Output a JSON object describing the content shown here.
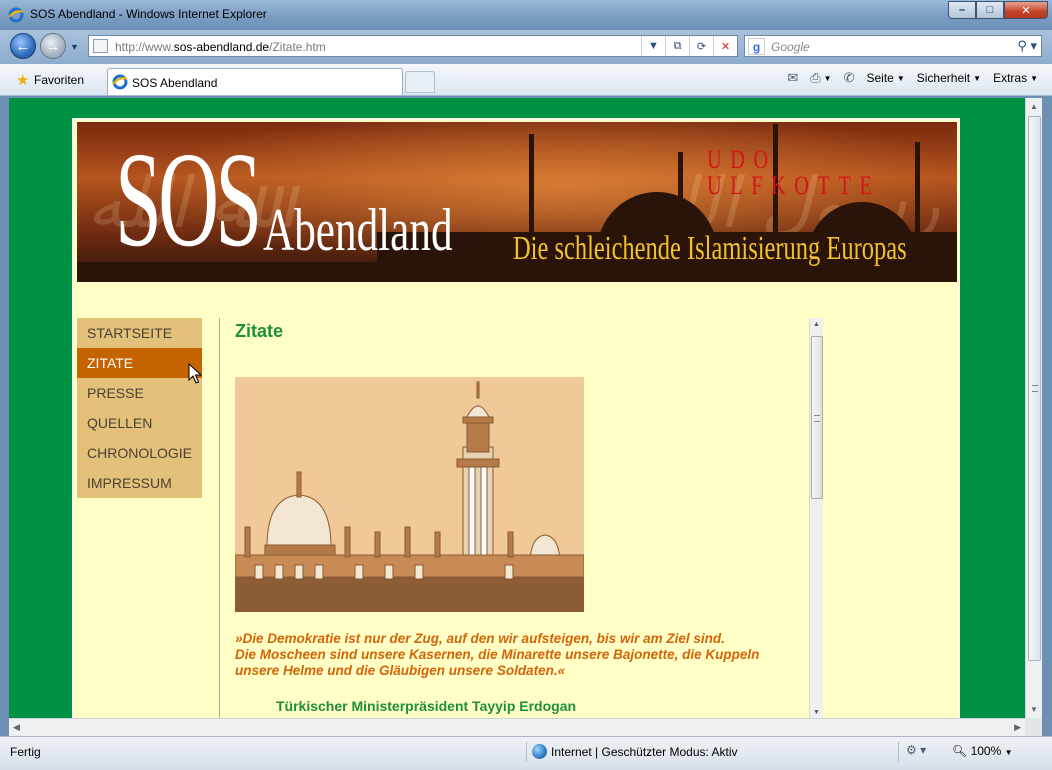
{
  "window": {
    "title": "SOS Abendland - Windows Internet Explorer",
    "minimize": "–",
    "maximize": "□",
    "close": "✕"
  },
  "address": {
    "url_prefix": "http://www.",
    "url_host": "sos-abendland.de",
    "url_path": "/Zitate.htm",
    "search_placeholder": "Google"
  },
  "favorites": {
    "label": "Favoriten"
  },
  "tab": {
    "label": "SOS Abendland"
  },
  "commandbar": {
    "items": [
      {
        "label": "Seite"
      },
      {
        "label": "Sicherheit"
      },
      {
        "label": "Extras"
      }
    ]
  },
  "banner": {
    "title_big": "SOS",
    "title_rest": "Abendland",
    "author": "UDO ULFKOTTE",
    "subtitle": "Die schleichende Islamisierung Europas"
  },
  "nav": {
    "items": [
      {
        "label": "STARTSEITE",
        "active": false
      },
      {
        "label": "ZITATE",
        "active": true
      },
      {
        "label": "PRESSE",
        "active": false
      },
      {
        "label": "QUELLEN",
        "active": false
      },
      {
        "label": "CHRONOLOGIE",
        "active": false
      },
      {
        "label": "IMPRESSUM",
        "active": false
      }
    ]
  },
  "content": {
    "heading": "Zitate",
    "quote_line1": "»Die Demokratie ist nur der Zug, auf den wir aufsteigen, bis wir am Ziel sind.",
    "quote_line2": "Die Moscheen sind unsere Kasernen, die Minarette unsere Bajonette, die Kuppeln unsere Helme und die Gläubigen unsere Soldaten.«",
    "source": "Türkischer Ministerpräsident Tayyip Erdogan"
  },
  "status": {
    "left": "Fertig",
    "zone": "Internet | Geschützter Modus: Aktiv",
    "zoom": "100%"
  },
  "colors": {
    "page_green": "#009244",
    "content_bg": "#ffffc6",
    "nav_bg": "#e3c17a",
    "nav_active": "#c46300",
    "heading_green": "#1f8f3e",
    "quote_orange": "#d4640a"
  }
}
